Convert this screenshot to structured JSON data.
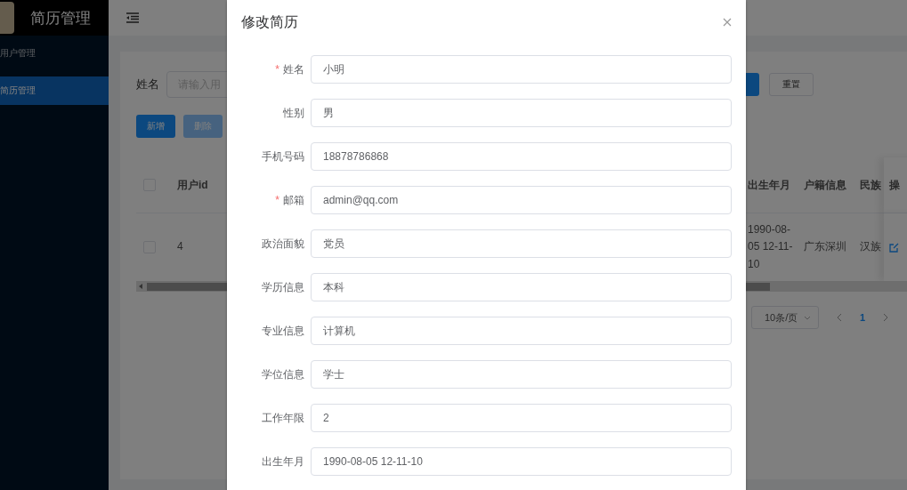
{
  "sidebar": {
    "title": "简历管理",
    "items": [
      {
        "label": "用户管理",
        "selected": false
      },
      {
        "label": "简历管理",
        "selected": true
      }
    ]
  },
  "search": {
    "label": "姓名",
    "placeholder": "请输入用"
  },
  "actions": [
    {
      "label": "新增",
      "disabled": false
    },
    {
      "label": "删除",
      "disabled": true
    }
  ],
  "reset": "重置",
  "table": {
    "header_checked": false,
    "columns": [
      "用户id",
      "出生年月",
      "户籍信息",
      "民族",
      "操"
    ],
    "rows": [
      {
        "checked": false,
        "cells": [
          "4",
          "1990-08-05 12-11-10",
          "广东深圳",
          "汉族"
        ]
      }
    ]
  },
  "pagination": {
    "page_size": "10条/页",
    "pages": [
      {
        "label": "1",
        "selected": true
      }
    ]
  },
  "modal": {
    "title": "修改简历",
    "required_mark": "*",
    "fields": [
      {
        "label": "姓名",
        "value": "小明",
        "required": true
      },
      {
        "label": "性别",
        "value": "男",
        "required": false
      },
      {
        "label": "手机号码",
        "value": "18878786868",
        "required": false
      },
      {
        "label": "邮箱",
        "value": "admin@qq.com",
        "required": true
      },
      {
        "label": "政治面貌",
        "value": "党员",
        "required": false
      },
      {
        "label": "学历信息",
        "value": "本科",
        "required": false
      },
      {
        "label": "专业信息",
        "value": "计算机",
        "required": false
      },
      {
        "label": "学位信息",
        "value": "学士",
        "required": false
      },
      {
        "label": "工作年限",
        "value": "2",
        "required": false
      },
      {
        "label": "出生年月",
        "value": "1990-08-05 12-11-10",
        "required": false
      }
    ]
  }
}
